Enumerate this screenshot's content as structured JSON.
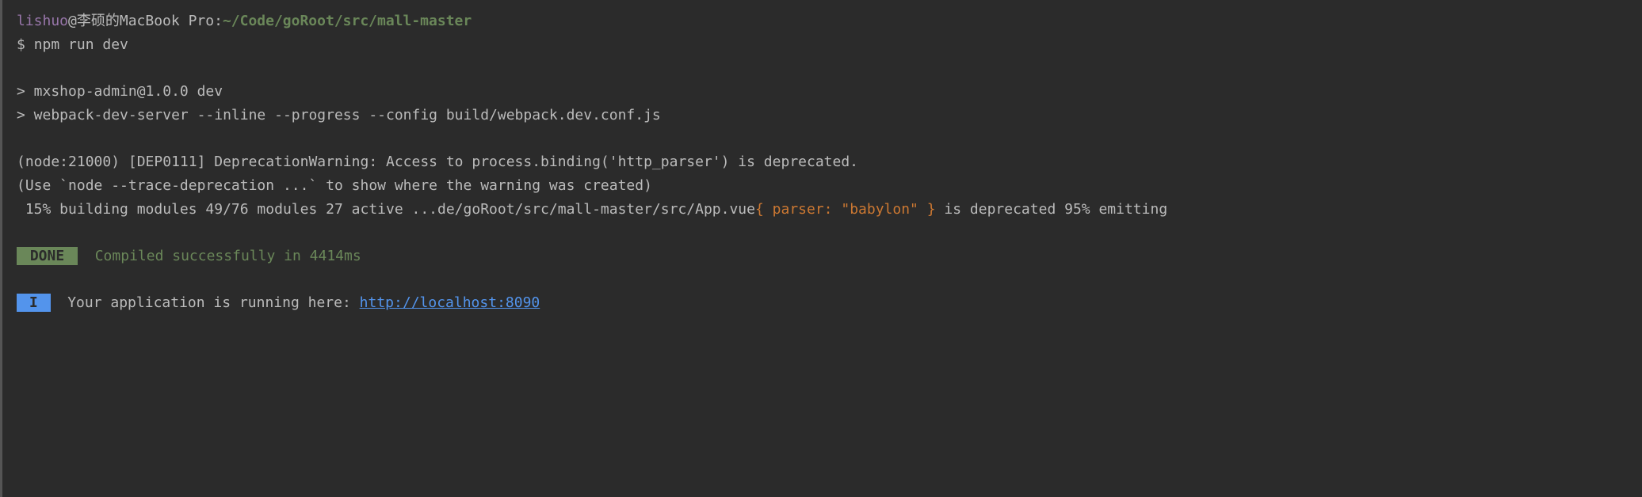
{
  "prompt": {
    "user": "lishuo",
    "at": "@",
    "host": "李硕的MacBook Pro",
    "colon": ":",
    "path": "~/Code/goRoot/src/mall-master",
    "dollar": "$ ",
    "command": "npm run dev"
  },
  "lines": {
    "script1": "> mxshop-admin@1.0.0 dev",
    "script2": "> webpack-dev-server --inline --progress --config build/webpack.dev.conf.js",
    "warn1": "(node:21000) [DEP0111] DeprecationWarning: Access to process.binding('http_parser') is deprecated.",
    "warn2": "(Use `node --trace-deprecation ...` to show where the warning was created)",
    "build_prefix": " 15% building modules 49/76 modules 27 active ...de/goRoot/src/mall-master/src/App.vue",
    "build_yellow": "{ parser: \"babylon\" }",
    "build_suffix": " is deprecated 95% emitting"
  },
  "done": {
    "badge": " DONE ",
    "text": "Compiled successfully in 4414ms"
  },
  "info": {
    "badge": " I ",
    "text": "Your application is running here: ",
    "url": "http://localhost:8090"
  }
}
